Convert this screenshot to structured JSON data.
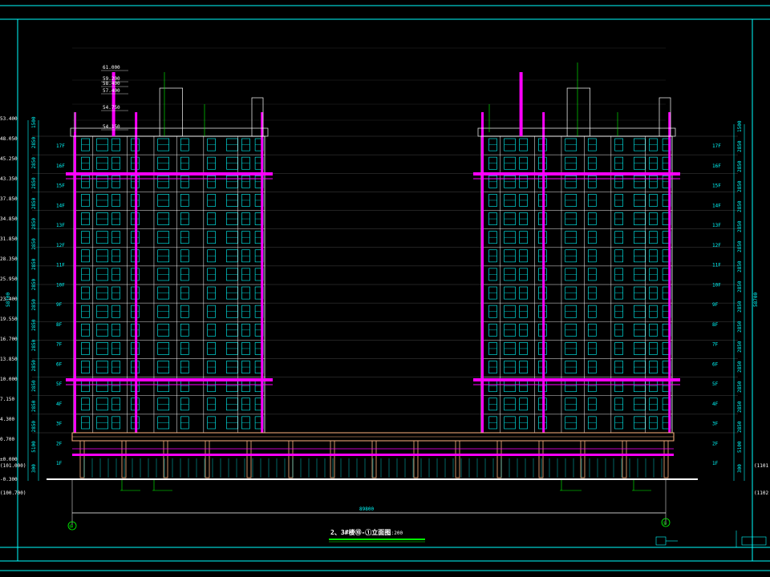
{
  "drawing": {
    "title": "2、3#楼⑩-①立面图",
    "scale": "1:200",
    "total_dimension": "89800",
    "axis_left": "⑩",
    "axis_right": "①",
    "height_dim": "58700"
  },
  "levels": [
    {
      "v": "61.000"
    },
    {
      "v": "59.200"
    },
    {
      "v": "58.400"
    },
    {
      "v": "57.400"
    },
    {
      "v": "54.750"
    },
    {
      "v": "54.150"
    }
  ],
  "left_elevations": [
    "53.400",
    "48.050",
    "45.250",
    "43.350",
    "37.850",
    "34.850",
    "31.850",
    "28.350",
    "25.950",
    "23.400",
    "19.550",
    "16.700",
    "13.850",
    "10.000",
    "7.150",
    "4.300",
    "0.700",
    "±0.000",
    "-0.300"
  ],
  "left_bottom_notes": [
    "(101.000)",
    "(100.700)"
  ],
  "right_bottom_notes": [
    "(1101",
    "(1102"
  ],
  "floor_labels": [
    "17F",
    "16F",
    "15F",
    "14F",
    "13F",
    "12F",
    "11F",
    "10F",
    "9F",
    "8F",
    "7F",
    "6F",
    "5F",
    "4F",
    "3F",
    "2F",
    "1F"
  ],
  "dims_vertical": [
    "1500",
    "2850",
    "2850",
    "2850",
    "2850",
    "2850",
    "2850",
    "2850",
    "2850",
    "2850",
    "2850",
    "2850",
    "2850",
    "2850",
    "2850",
    "2850",
    "5100",
    "300"
  ],
  "colors": {
    "magenta": "#ff00ff",
    "cyan": "#00ffff",
    "white": "#ffffff",
    "peach": "#ffb380",
    "green": "#00ff00"
  }
}
